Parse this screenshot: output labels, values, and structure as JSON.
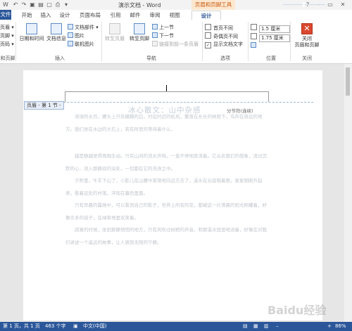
{
  "window": {
    "title": "演示文档 - Word",
    "context_tools": "页眉和页脚工具"
  },
  "quick_access": [
    "undo-icon",
    "redo-icon",
    "save-icon",
    "open-icon",
    "new-icon",
    "print-icon",
    "customize-icon"
  ],
  "tabs": [
    "文件",
    "开始",
    "插入",
    "设计",
    "页面布局",
    "引用",
    "邮件",
    "审阅",
    "视图",
    "设计"
  ],
  "ribbon": {
    "group1": {
      "label": "和页脚",
      "items": [
        "页眉 ▾",
        "页脚 ▾",
        "页码 ▾"
      ]
    },
    "group2": {
      "label": "插入",
      "date_time": "日期和时间",
      "doc_info": "文档信息",
      "doc_parts": "文档部件 ▾",
      "picture": "图片",
      "online_picture": "联机图片"
    },
    "group3": {
      "label": "导航",
      "goto_header": "转至页眉",
      "goto_footer": "转至页脚",
      "prev": "上一节",
      "next": "下一节",
      "link_prev": "链接到前一条页眉"
    },
    "group4": {
      "label": "选项",
      "first_page": "首页不同",
      "odd_even": "奇偶页不同",
      "show_text": "显示文档文字",
      "show_text_checked": "✓"
    },
    "group5": {
      "label": "位置",
      "header_pos": "1.5 厘米",
      "footer_pos": "1.75 厘米"
    },
    "group6": {
      "label": "关闭",
      "close": "关闭\n页眉和页脚",
      "close_line1": "关闭",
      "close_line2": "页眉和页脚"
    }
  },
  "document": {
    "header_tag": "页眉 - 第 1 节 -",
    "section_tag": "分节符(连续)",
    "title": "冰心散文：山中杂感",
    "paragraphs": [
      "溶溶的水月，螺头上只有模糊的白，时远时近的松风，撒落在长长的林荫下，鸟声在很远的地方。我们坐在水边的大石上，若有所思的等待着什么，",
      "越是静越觉得周围生动。只有山间的流水声响，一直不停地奔流着。它从此我们的想象，流过沉默的心，流入那静寂的深处，一切都在它的洗涤之中。",
      "夕照里，牛羊下山了，小影儿在山腰中渐渐地向远方去了，溪水在谷底唱着歌，星星刚刚升起来，看着远处的村落，浮现在暮色里面。",
      "只有早晨的露珠中，可以看到自己的影子，世界上所有的花，都被这一片清晨的阳光照耀着，好像许多的孩子，在绿草地里欢笑着。",
      "寂寞的时候，坐到那静悄悄的地方，只有风吹过树梢的声音，和那溪水悠悠地流着，好像在对我们讲述一个遥远的故事，让人感到无限的宁静。"
    ]
  },
  "status": {
    "page": "第 1 页，共 1 页",
    "words": "463 个字",
    "lang": "中文(中国)",
    "zoom": "86%",
    "zoom_value": 0.86
  },
  "watermark": "Baidu 经验"
}
